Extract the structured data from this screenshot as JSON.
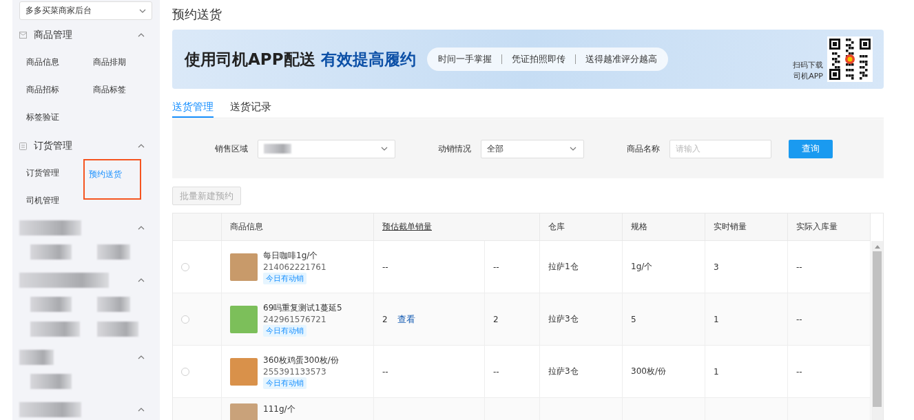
{
  "sidebar": {
    "store_select": {
      "value": "多多买菜商家后台"
    },
    "groups": [
      {
        "title": "商品管理",
        "expanded": true,
        "items": [
          {
            "label": "商品信息",
            "selected": false,
            "highlighted": false
          },
          {
            "label": "商品排期",
            "selected": false,
            "highlighted": false
          },
          {
            "label": "商品招标",
            "selected": false,
            "highlighted": false
          },
          {
            "label": "商品标签",
            "selected": false,
            "highlighted": false
          },
          {
            "label": "标签验证",
            "selected": false,
            "highlighted": false
          }
        ]
      },
      {
        "title": "订货管理",
        "expanded": true,
        "items": [
          {
            "label": "订货管理",
            "selected": false,
            "highlighted": false
          },
          {
            "label": "预约送货",
            "selected": true,
            "highlighted": true
          },
          {
            "label": "司机管理",
            "selected": false,
            "highlighted": false
          }
        ]
      }
    ]
  },
  "page_title": "预约送货",
  "banner": {
    "headline": "使用司机APP配送",
    "headline_accent": "有效提高履约",
    "features": [
      "时间一手掌握",
      "凭证拍照即传",
      "送得越准评分越高"
    ],
    "qr_caption": [
      "扫码下载",
      "司机APP"
    ]
  },
  "tabs": [
    {
      "label": "送货管理",
      "selected": true
    },
    {
      "label": "送货记录",
      "selected": false
    }
  ],
  "filters": {
    "sales_region": {
      "label": "销售区域"
    },
    "sales_status": {
      "label": "动销情况",
      "value": "全部"
    },
    "product_name": {
      "label": "商品名称",
      "placeholder": "请输入"
    },
    "query_button": "查询"
  },
  "batch_button": {
    "label": "批量新建预约",
    "disabled": true
  },
  "table": {
    "columns": [
      "商品信息",
      "预估截单销量",
      "仓库",
      "规格",
      "实时销量",
      "实际入库量"
    ],
    "rows": [
      {
        "selected": false,
        "name": "每日咖啡1g/个",
        "id": "214062221761",
        "tag": "今日有动销",
        "forecast": "--",
        "forecast_2": "--",
        "warehouse": "拉萨1仓",
        "spec": "1g/个",
        "realtime_sales": "3",
        "actual_stock": "--"
      },
      {
        "selected": false,
        "name": "69吗重复测试1蔓延5",
        "id": "242961576721",
        "tag": "今日有动销",
        "forecast": "2",
        "forecast_link": "查看",
        "forecast_2": "2",
        "warehouse": "拉萨3仓",
        "spec": "5",
        "realtime_sales": "1",
        "actual_stock": "--"
      },
      {
        "selected": false,
        "name": "360枚鸡蛋300枚/份",
        "id": "255391133573",
        "tag": "今日有动销",
        "forecast": "--",
        "forecast_2": "--",
        "warehouse": "拉萨3仓",
        "spec": "300枚/份",
        "realtime_sales": "1",
        "actual_stock": "--"
      },
      {
        "name": "111g/个"
      }
    ]
  }
}
